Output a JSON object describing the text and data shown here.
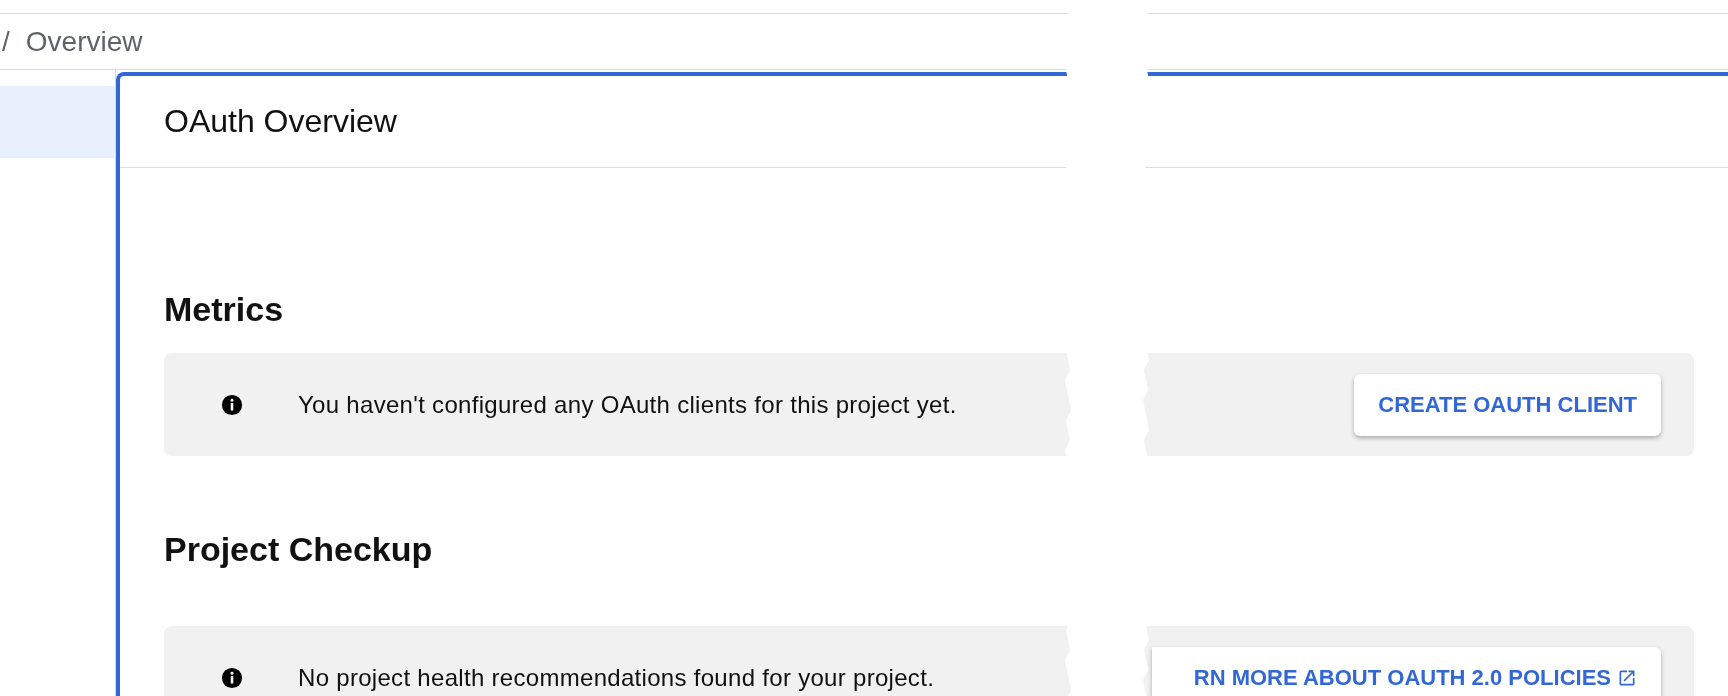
{
  "breadcrumb": {
    "separator": "/",
    "current": "Overview"
  },
  "sidebar": {
    "items": [
      {
        "selected": true
      }
    ]
  },
  "card": {
    "title": "OAuth Overview",
    "sections": [
      {
        "heading": "Metrics",
        "notice": {
          "text": "You haven't configured any OAuth clients for this project yet.",
          "action": {
            "label": "CREATE OAUTH CLIENT",
            "external": false
          }
        }
      },
      {
        "heading": "Project Checkup",
        "notice": {
          "text": "No project health recommendations found for your project.",
          "action": {
            "label": "RN MORE ABOUT OAUTH 2.0 POLICIES",
            "external": true
          }
        }
      }
    ]
  }
}
